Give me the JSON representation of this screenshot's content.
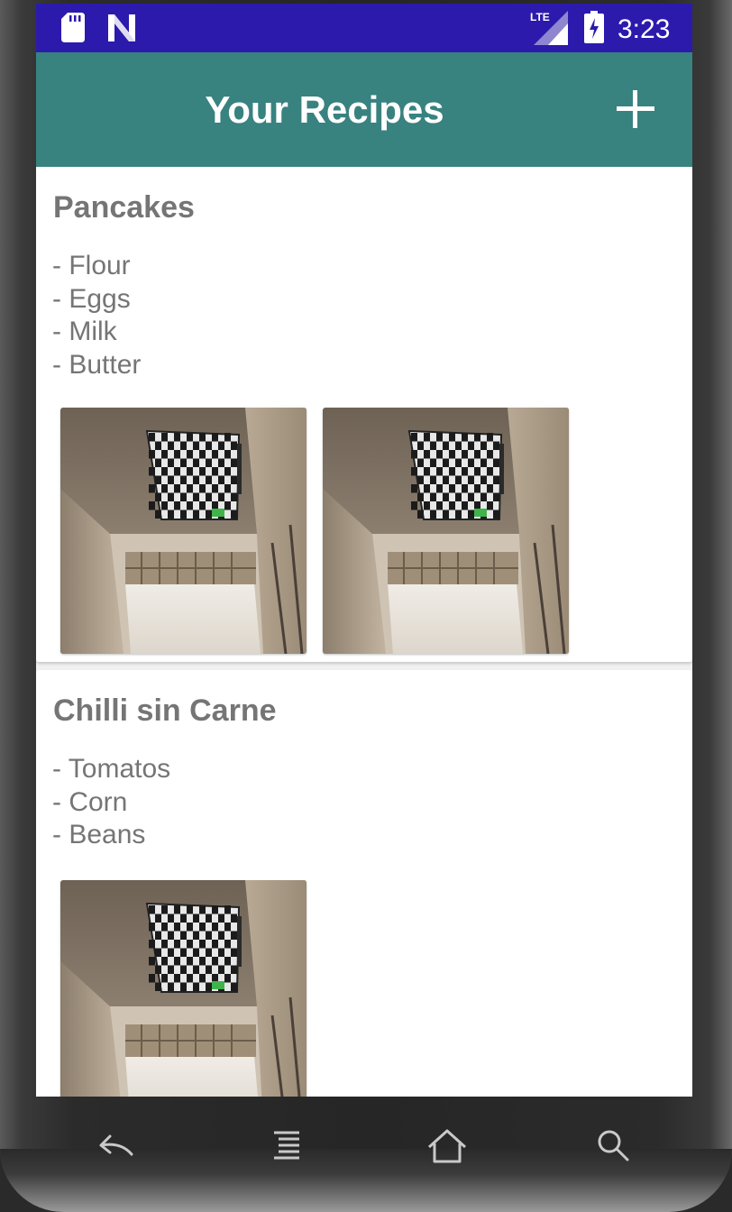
{
  "status_bar": {
    "time": "3:23",
    "network_label": "LTE",
    "icons": [
      "sd-card-icon",
      "n-notification-icon",
      "lte-signal-icon",
      "battery-charging-icon"
    ],
    "background": "#2c1aad"
  },
  "app_bar": {
    "title": "Your Recipes",
    "add_icon": "plus-icon",
    "background": "#388280"
  },
  "recipes": [
    {
      "title": "Pancakes",
      "ingredients": [
        "- Flour",
        "- Eggs",
        "- Milk",
        "- Butter"
      ],
      "photo_count": 2
    },
    {
      "title": "Chilli sin Carne",
      "ingredients": [
        "- Tomatos",
        "- Corn",
        "- Beans"
      ],
      "photo_count": 1
    }
  ],
  "nav_bar": {
    "icons": [
      "back-icon",
      "menu-icon",
      "home-icon",
      "search-icon"
    ]
  },
  "colors": {
    "text_gray": "#757575",
    "card_bg": "#ffffff",
    "list_bg": "#f1f1f1"
  }
}
